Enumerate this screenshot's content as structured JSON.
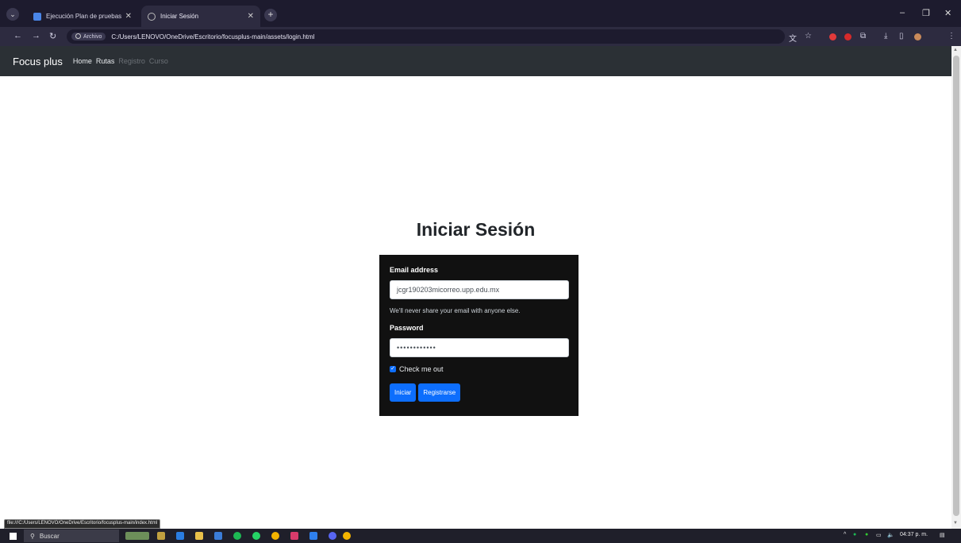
{
  "browser": {
    "tabs": [
      {
        "title": "Ejecución Plan de pruebas - Do",
        "active": false
      },
      {
        "title": "Iniciar Sesión",
        "active": true
      }
    ],
    "address_chip": "Archivo",
    "url": "C:/Users/LENOVO/OneDrive/Escritorio/focusplus-main/assets/login.html",
    "status_url": "file:///C:/Users/LENOVO/OneDrive/Escritorio/focusplus-main/index.html"
  },
  "navbar": {
    "brand": "Focus plus",
    "links": [
      {
        "label": "Home",
        "active": true
      },
      {
        "label": "Rutas",
        "active": true
      },
      {
        "label": "Registro",
        "active": false
      },
      {
        "label": "Curso",
        "active": false
      }
    ]
  },
  "login": {
    "title": "Iniciar Sesión",
    "email_label": "Email address",
    "email_value": "jcgr190203micorreo.upp.edu.mx",
    "email_help": "We'll never share your email with anyone else.",
    "password_label": "Password",
    "password_value": "••••••••••••",
    "checkbox_label": "Check me out",
    "checkbox_checked": true,
    "login_button": "Iniciar",
    "register_button": "Registrarse"
  },
  "taskbar": {
    "search_label": "Buscar",
    "time": "04:37 p. m."
  },
  "colors": {
    "navbar": "#2b3035",
    "card": "#111111",
    "primary": "#0d6efd"
  }
}
